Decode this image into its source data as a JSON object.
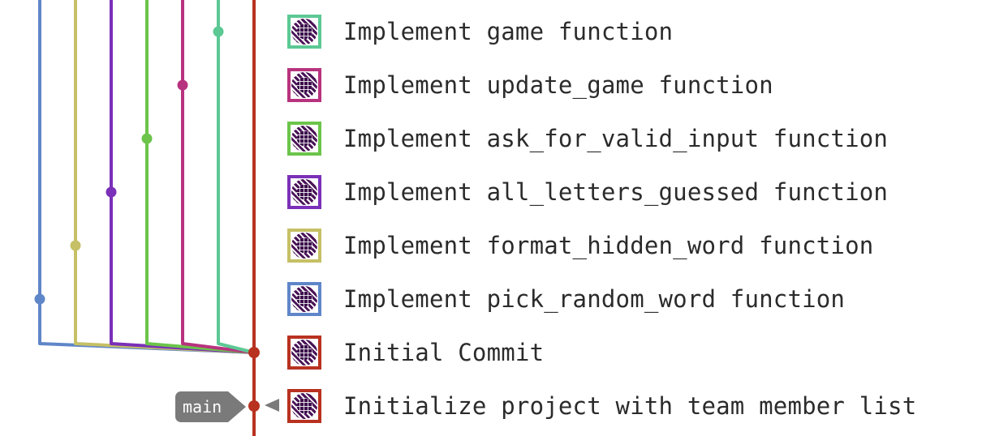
{
  "commits": [
    {
      "message": "Implement game function",
      "branch_color": "#5cc894"
    },
    {
      "message": "Implement update_game function",
      "branch_color": "#b8337f"
    },
    {
      "message": "Implement ask_for_valid_input function",
      "branch_color": "#6cc44a"
    },
    {
      "message": "Implement all_letters_guessed function",
      "branch_color": "#7a30b8"
    },
    {
      "message": "Implement format_hidden_word function",
      "branch_color": "#c6c066"
    },
    {
      "message": "Implement pick_random_word function",
      "branch_color": "#5f86c8"
    },
    {
      "message": "Initial Commit",
      "branch_color": "#b83220"
    },
    {
      "message": "Initialize project with team member list",
      "branch_color": "#b83220"
    }
  ],
  "branch": {
    "label": "main",
    "tag_color": "#7a7a7a"
  },
  "main_line_color": "#b83220"
}
